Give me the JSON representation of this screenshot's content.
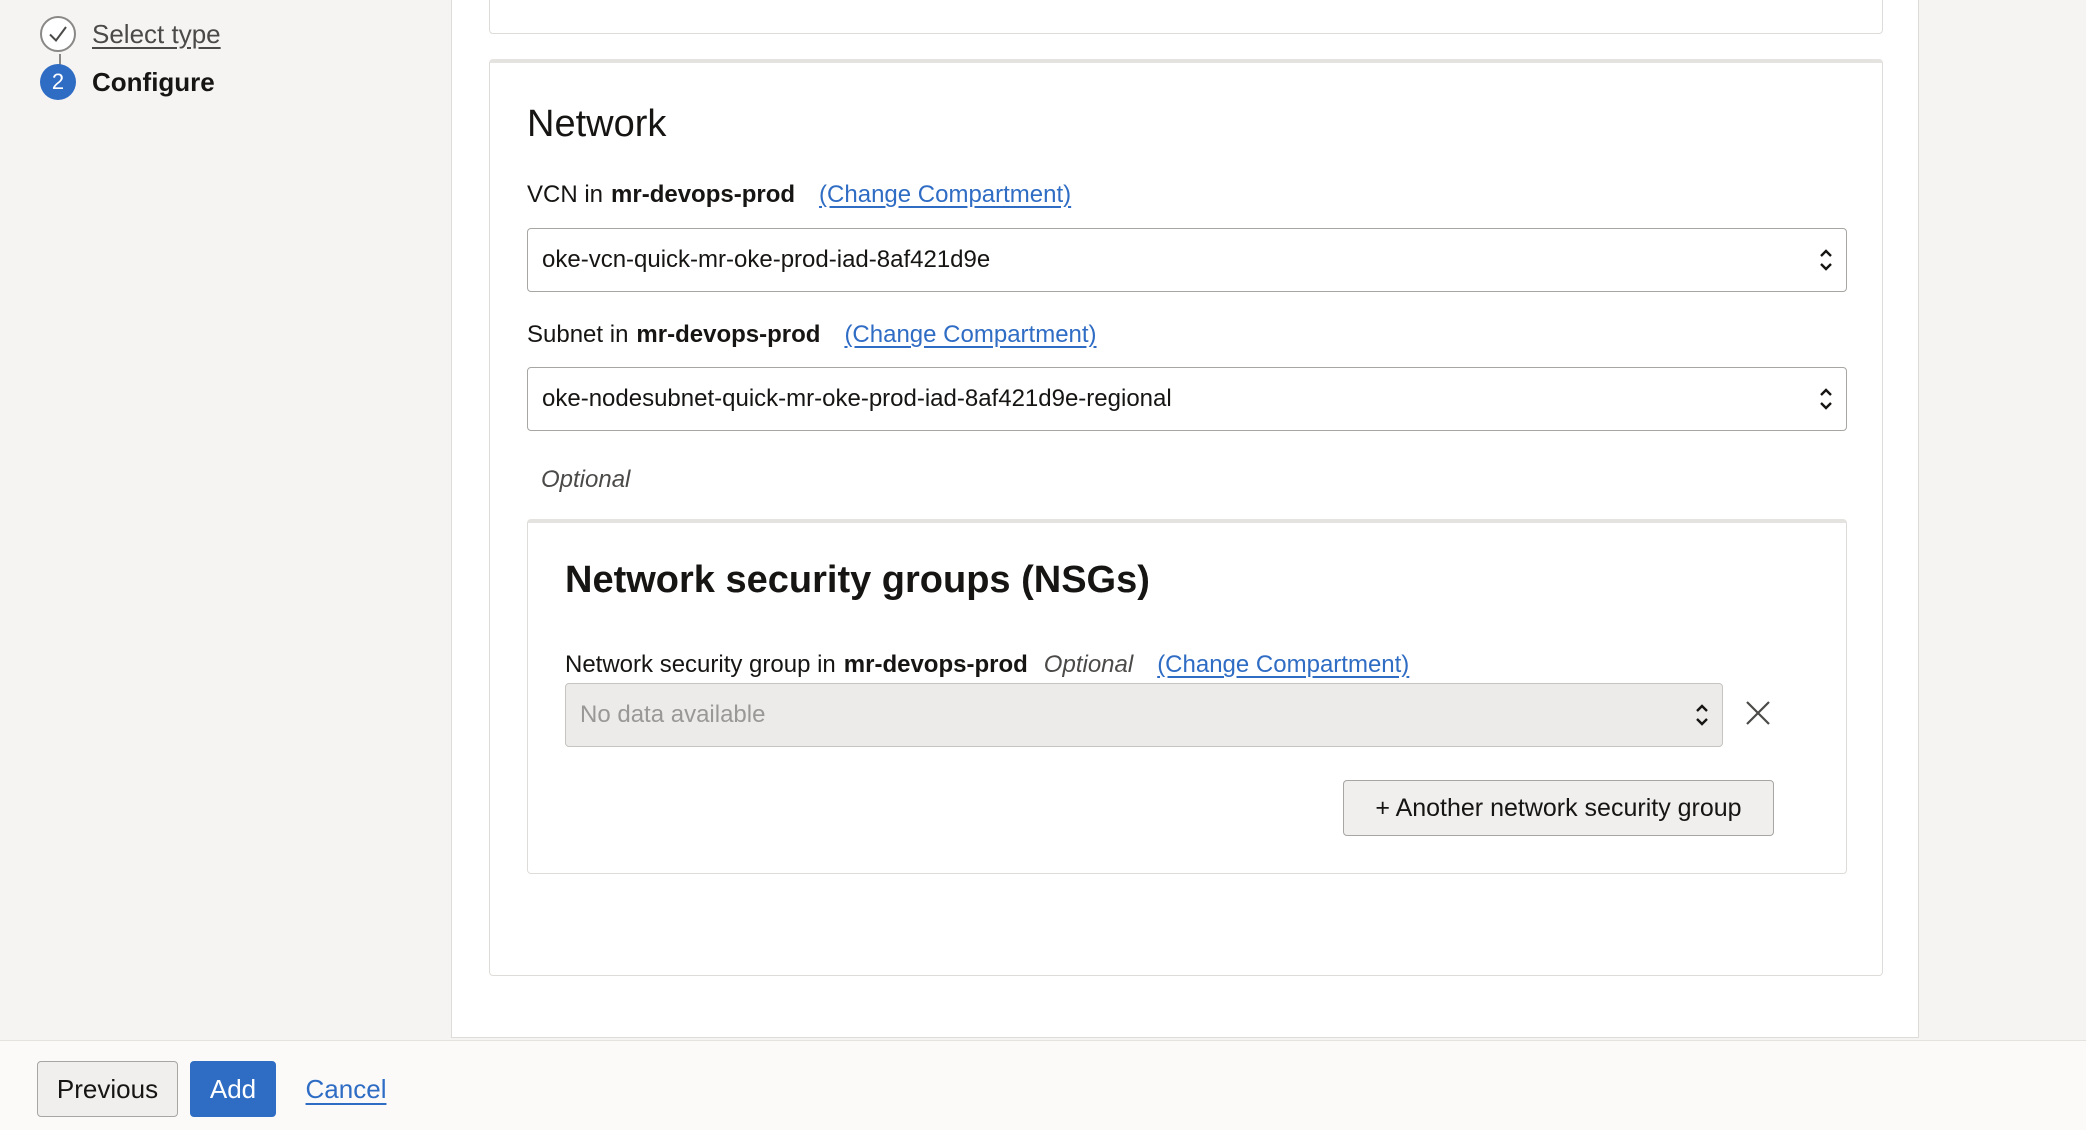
{
  "stepper": {
    "steps": [
      {
        "label": "Select type",
        "state": "completed"
      },
      {
        "label": "Configure",
        "number": "2",
        "state": "current"
      }
    ]
  },
  "network": {
    "title": "Network",
    "vcn": {
      "label_prefix": "VCN in",
      "compartment": "mr-devops-prod",
      "change_link": "(Change Compartment)",
      "value": "oke-vcn-quick-mr-oke-prod-iad-8af421d9e"
    },
    "subnet": {
      "label_prefix": "Subnet in",
      "compartment": "mr-devops-prod",
      "change_link": "(Change Compartment)",
      "value": "oke-nodesubnet-quick-mr-oke-prod-iad-8af421d9e-regional"
    },
    "optional_note": "Optional",
    "nsg": {
      "title": "Network security groups (NSGs)",
      "label_prefix": "Network security group in",
      "compartment": "mr-devops-prod",
      "optional": "Optional",
      "change_link": "(Change Compartment)",
      "placeholder": "No data available",
      "add_button": "+ Another network security group"
    }
  },
  "footer": {
    "previous": "Previous",
    "add": "Add",
    "cancel": "Cancel"
  },
  "colors": {
    "accent": "#2f6cc4",
    "background": "#f5f4f2",
    "panel": "#ffffff"
  },
  "icons": {
    "completed_step": "check-icon",
    "select_arrows": "up-down-chevron-icon",
    "remove": "close-icon"
  }
}
